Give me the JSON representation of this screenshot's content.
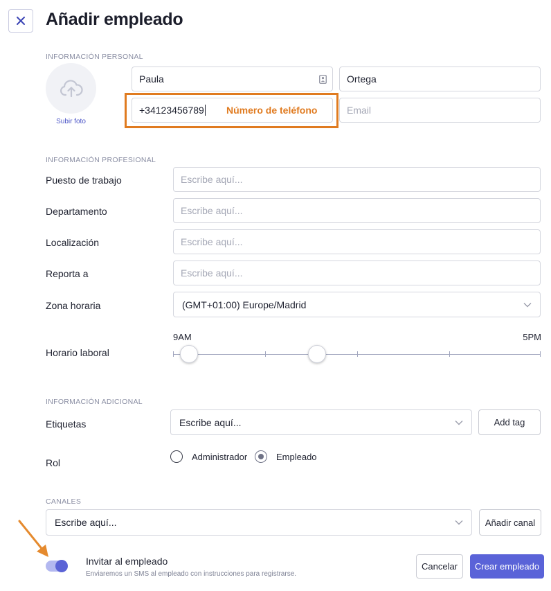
{
  "header": {
    "title": "Añadir empleado",
    "close_icon": "close-icon"
  },
  "personal": {
    "section_label": "INFORMACIÓN PERSONAL",
    "upload_label": "Subir foto",
    "first_name": "Paula",
    "last_name": "Ortega",
    "phone": "+34123456789",
    "phone_annotation": "Número de teléfono",
    "email_placeholder": "Email"
  },
  "professional": {
    "section_label": "INFORMACIÓN PROFESIONAL",
    "job_label": "Puesto de trabajo",
    "job_placeholder": "Escribe aquí...",
    "department_label": "Departamento",
    "department_placeholder": "Escribe aquí...",
    "location_label": "Localización",
    "location_placeholder": "Escribe aquí...",
    "reports_label": "Reporta a",
    "reports_placeholder": "Escribe aquí...",
    "timezone_label": "Zona horaria",
    "timezone_value": "(GMT+01:00) Europe/Madrid",
    "schedule_label": "Horario laboral",
    "schedule_start": "9AM",
    "schedule_end": "5PM"
  },
  "additional": {
    "section_label": "INFORMACIÓN ADICIONAL",
    "tags_label": "Etiquetas",
    "tags_placeholder": "Escribe aquí...",
    "add_tag_label": "Add tag",
    "role_label": "Rol",
    "role_admin": "Administrador",
    "role_employee": "Empleado",
    "role_selected": "Empleado"
  },
  "channels": {
    "section_label": "CANALES",
    "placeholder": "Escribe aquí...",
    "add_channel_label": "Añadir canal"
  },
  "footer": {
    "invite_title": "Invitar al empleado",
    "invite_desc": "Enviaremos un SMS al empleado con instrucciones para registrarse.",
    "invite_enabled": true,
    "cancel_label": "Cancelar",
    "create_label": "Crear empleado"
  },
  "colors": {
    "accent": "#5a63d8",
    "annotation": "#e07b20"
  }
}
